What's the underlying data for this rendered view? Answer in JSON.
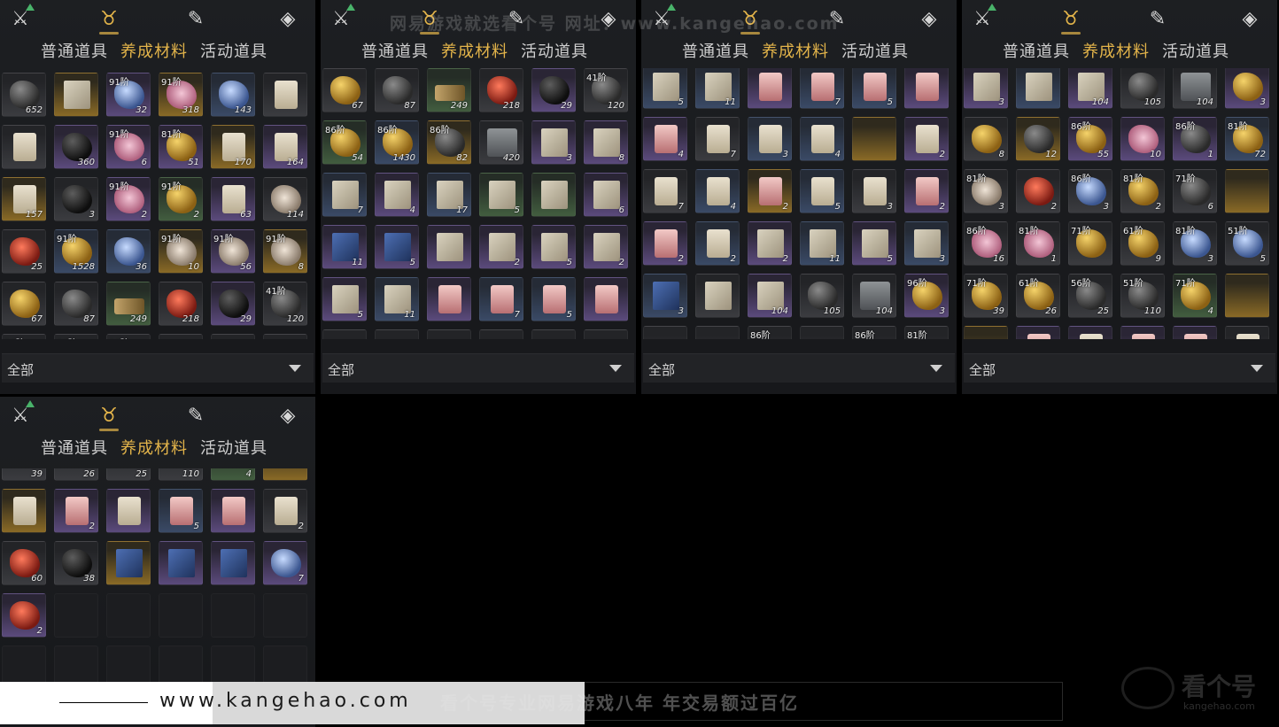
{
  "panels": [
    {
      "icons": [
        "crossed-swords-icon",
        "pouch-icon",
        "scroll-icon",
        "token-icon"
      ],
      "active_icon": 1,
      "tabs": [
        "普通道具",
        "养成材料",
        "活动道具"
      ],
      "active_tab": 1,
      "filter": "全部",
      "rows": [
        [
          {
            "a": "rock",
            "r": "gray",
            "c": "652"
          },
          {
            "a": "book",
            "r": "gold",
            "c": ""
          },
          {
            "a": "blue",
            "r": "purple",
            "t": "91阶",
            "c": "32"
          },
          {
            "a": "flower",
            "r": "gold",
            "t": "91阶",
            "c": "318"
          },
          {
            "a": "blue",
            "r": "blue",
            "c": "143"
          },
          {
            "a": "scroll",
            "r": "gray",
            "c": ""
          }
        ],
        [
          {
            "a": "scroll",
            "r": "gray",
            "c": ""
          },
          {
            "a": "dark",
            "r": "purple",
            "c": "360"
          },
          {
            "a": "flower",
            "r": "purple",
            "t": "91阶",
            "c": "6"
          },
          {
            "a": "ore",
            "r": "purple",
            "t": "81阶",
            "c": "51"
          },
          {
            "a": "scroll",
            "r": "gold",
            "c": "170"
          },
          {
            "a": "scroll",
            "r": "purple",
            "c": "164"
          }
        ],
        [
          {
            "a": "scroll",
            "r": "gold",
            "c": "157"
          },
          {
            "a": "dark",
            "r": "gray",
            "c": "3"
          },
          {
            "a": "flower",
            "r": "purple",
            "t": "91阶",
            "c": "2"
          },
          {
            "a": "ore",
            "r": "green",
            "t": "91阶",
            "c": "2"
          },
          {
            "a": "scroll",
            "r": "purple",
            "c": "63"
          },
          {
            "a": "shell",
            "r": "gray",
            "c": "114"
          }
        ],
        [
          {
            "a": "red",
            "r": "gray",
            "c": "25"
          },
          {
            "a": "ore",
            "r": "blue",
            "t": "91阶",
            "c": "1528"
          },
          {
            "a": "blue",
            "r": "blue",
            "c": "36"
          },
          {
            "a": "shell",
            "r": "gold",
            "t": "91阶",
            "c": "10"
          },
          {
            "a": "shell",
            "r": "purple",
            "t": "91阶",
            "c": "56"
          },
          {
            "a": "shell",
            "r": "gold",
            "t": "91阶",
            "c": "8"
          }
        ],
        [
          {
            "a": "ore",
            "r": "gray",
            "c": "67"
          },
          {
            "a": "rock",
            "r": "gray",
            "c": "87"
          },
          {
            "a": "wood",
            "r": "green",
            "c": "249"
          },
          {
            "a": "red",
            "r": "gray",
            "c": "218"
          },
          {
            "a": "dark",
            "r": "purple",
            "c": "29"
          },
          {
            "a": "rock",
            "r": "gray",
            "t": "41阶",
            "c": "120"
          }
        ],
        [
          {
            "a": "none",
            "r": "gray",
            "t": "86阶",
            "c": ""
          },
          {
            "a": "none",
            "r": "gray",
            "t": "86阶",
            "c": ""
          },
          {
            "a": "none",
            "r": "gray",
            "t": "86阶",
            "c": ""
          },
          {
            "a": "none",
            "r": "gray",
            "c": ""
          },
          {
            "a": "none",
            "r": "gray",
            "c": ""
          },
          {
            "a": "none",
            "r": "gray",
            "c": ""
          }
        ]
      ]
    },
    {
      "icons": [
        "crossed-swords-icon",
        "pouch-icon",
        "scroll-icon",
        "token-icon"
      ],
      "active_icon": 1,
      "tabs": [
        "普通道具",
        "养成材料",
        "活动道具"
      ],
      "active_tab": 1,
      "filter": "全部",
      "rows": [
        [
          {
            "a": "ore",
            "r": "gray",
            "c": "67"
          },
          {
            "a": "rock",
            "r": "gray",
            "c": "87"
          },
          {
            "a": "wood",
            "r": "green",
            "c": "249"
          },
          {
            "a": "red",
            "r": "gray",
            "c": "218"
          },
          {
            "a": "dark",
            "r": "purple",
            "c": "29"
          },
          {
            "a": "rock",
            "r": "gray",
            "t": "41阶",
            "c": "120"
          }
        ],
        [
          {
            "a": "ore",
            "r": "green",
            "t": "86阶",
            "c": "54"
          },
          {
            "a": "ore",
            "r": "blue",
            "t": "86阶",
            "c": "1430"
          },
          {
            "a": "rock",
            "r": "gold",
            "t": "86阶",
            "c": "82"
          },
          {
            "a": "gray",
            "r": "gray",
            "c": "420"
          },
          {
            "a": "book",
            "r": "purple",
            "c": "3"
          },
          {
            "a": "book",
            "r": "purple",
            "c": "8"
          }
        ],
        [
          {
            "a": "book",
            "r": "blue",
            "c": "7"
          },
          {
            "a": "book",
            "r": "purple",
            "c": "4"
          },
          {
            "a": "book",
            "r": "blue",
            "c": "17"
          },
          {
            "a": "book",
            "r": "green",
            "c": "5"
          },
          {
            "a": "book",
            "r": "green",
            "c": ""
          },
          {
            "a": "book",
            "r": "purple",
            "c": "6"
          }
        ],
        [
          {
            "a": "bluebook",
            "r": "purple",
            "c": "11"
          },
          {
            "a": "bluebook",
            "r": "purple",
            "c": "5"
          },
          {
            "a": "book",
            "r": "purple",
            "c": ""
          },
          {
            "a": "book",
            "r": "purple",
            "c": "2"
          },
          {
            "a": "book",
            "r": "purple",
            "c": "5"
          },
          {
            "a": "book",
            "r": "purple",
            "c": "2"
          }
        ],
        [
          {
            "a": "book",
            "r": "purple",
            "c": "5"
          },
          {
            "a": "book",
            "r": "blue",
            "c": "11"
          },
          {
            "a": "pink",
            "r": "purple",
            "c": ""
          },
          {
            "a": "pink",
            "r": "blue",
            "c": "7"
          },
          {
            "a": "pink",
            "r": "blue",
            "c": "5"
          },
          {
            "a": "pink",
            "r": "purple",
            "c": ""
          }
        ],
        [
          {
            "a": "none",
            "r": "gray",
            "c": ""
          },
          {
            "a": "none",
            "r": "gray",
            "c": ""
          },
          {
            "a": "none",
            "r": "gray",
            "c": ""
          },
          {
            "a": "none",
            "r": "gray",
            "c": ""
          },
          {
            "a": "none",
            "r": "gray",
            "c": ""
          },
          {
            "a": "none",
            "r": "gray",
            "c": ""
          }
        ]
      ]
    },
    {
      "icons": [
        "crossed-swords-icon",
        "pouch-icon",
        "scroll-icon",
        "token-icon"
      ],
      "active_icon": 1,
      "tabs": [
        "普通道具",
        "养成材料",
        "活动道具"
      ],
      "active_tab": 1,
      "filter": "全部",
      "rows": [
        [
          {
            "a": "book",
            "r": "blue",
            "c": "5"
          },
          {
            "a": "book",
            "r": "blue",
            "c": "11"
          },
          {
            "a": "pink",
            "r": "purple",
            "c": ""
          },
          {
            "a": "pink",
            "r": "blue",
            "c": "7"
          },
          {
            "a": "pink",
            "r": "blue",
            "c": "5"
          },
          {
            "a": "pink",
            "r": "purple",
            "c": ""
          }
        ],
        [
          {
            "a": "pink",
            "r": "purple",
            "c": "4"
          },
          {
            "a": "scroll",
            "r": "gray",
            "c": "7"
          },
          {
            "a": "scroll",
            "r": "blue",
            "c": "3"
          },
          {
            "a": "scroll",
            "r": "blue",
            "c": "4"
          },
          {
            "a": "none",
            "r": "gold",
            "c": ""
          },
          {
            "a": "scroll",
            "r": "purple",
            "c": "2"
          }
        ],
        [
          {
            "a": "scroll",
            "r": "gray",
            "c": "7"
          },
          {
            "a": "scroll",
            "r": "blue",
            "c": "4"
          },
          {
            "a": "pink",
            "r": "gold",
            "c": "2"
          },
          {
            "a": "scroll",
            "r": "blue",
            "c": "5"
          },
          {
            "a": "scroll",
            "r": "gray",
            "c": "3"
          },
          {
            "a": "pink",
            "r": "purple",
            "c": "2"
          }
        ],
        [
          {
            "a": "pink",
            "r": "purple",
            "c": "2"
          },
          {
            "a": "scroll",
            "r": "blue",
            "c": "2"
          },
          {
            "a": "book",
            "r": "purple",
            "c": "2"
          },
          {
            "a": "book",
            "r": "blue",
            "c": "11"
          },
          {
            "a": "book",
            "r": "purple",
            "c": "5"
          },
          {
            "a": "book",
            "r": "blue",
            "c": "3"
          }
        ],
        [
          {
            "a": "bluebook",
            "r": "blue",
            "c": "3"
          },
          {
            "a": "book",
            "r": "gray",
            "c": ""
          },
          {
            "a": "book",
            "r": "purple",
            "c": "104"
          },
          {
            "a": "rock",
            "r": "gray",
            "c": "105"
          },
          {
            "a": "gray",
            "r": "gray",
            "c": "104"
          },
          {
            "a": "ore",
            "r": "purple",
            "t": "96阶",
            "c": "3"
          }
        ],
        [
          {
            "a": "none",
            "r": "gray",
            "c": ""
          },
          {
            "a": "none",
            "r": "gray",
            "c": ""
          },
          {
            "a": "none",
            "r": "gray",
            "t": "86阶",
            "c": ""
          },
          {
            "a": "none",
            "r": "gray",
            "c": ""
          },
          {
            "a": "none",
            "r": "gray",
            "t": "86阶",
            "c": ""
          },
          {
            "a": "none",
            "r": "gray",
            "t": "81阶",
            "c": ""
          }
        ]
      ]
    },
    {
      "icons": [
        "crossed-swords-icon",
        "pouch-icon",
        "scroll-icon",
        "token-icon"
      ],
      "active_icon": 1,
      "tabs": [
        "普通道具",
        "养成材料",
        "活动道具"
      ],
      "active_tab": 1,
      "filter": "全部",
      "rows": [
        [
          {
            "a": "book",
            "r": "purple",
            "c": "3"
          },
          {
            "a": "book",
            "r": "blue",
            "c": ""
          },
          {
            "a": "book",
            "r": "purple",
            "c": "104"
          },
          {
            "a": "rock",
            "r": "gray",
            "c": "105"
          },
          {
            "a": "gray",
            "r": "gray",
            "c": "104"
          },
          {
            "a": "ore",
            "r": "purple",
            "c": "3"
          }
        ],
        [
          {
            "a": "ore",
            "r": "gray",
            "c": "8"
          },
          {
            "a": "rock",
            "r": "gold",
            "c": "12"
          },
          {
            "a": "ore",
            "r": "purple",
            "t": "86阶",
            "c": "55"
          },
          {
            "a": "flower",
            "r": "purple",
            "c": "10"
          },
          {
            "a": "rock",
            "r": "purple",
            "t": "86阶",
            "c": "1"
          },
          {
            "a": "ore",
            "r": "blue",
            "t": "81阶",
            "c": "72"
          }
        ],
        [
          {
            "a": "shell",
            "r": "gray",
            "t": "81阶",
            "c": "3"
          },
          {
            "a": "red",
            "r": "gray",
            "c": "2"
          },
          {
            "a": "blue",
            "r": "gray",
            "t": "86阶",
            "c": "3"
          },
          {
            "a": "ore",
            "r": "gray",
            "t": "81阶",
            "c": "2"
          },
          {
            "a": "rock",
            "r": "gray",
            "t": "71阶",
            "c": "6"
          },
          {
            "a": "none",
            "r": "gold",
            "c": ""
          }
        ],
        [
          {
            "a": "flower",
            "r": "gray",
            "t": "86阶",
            "c": "16"
          },
          {
            "a": "flower",
            "r": "gray",
            "t": "81阶",
            "c": "1"
          },
          {
            "a": "ore",
            "r": "gray",
            "t": "71阶",
            "c": ""
          },
          {
            "a": "ore",
            "r": "gray",
            "t": "61阶",
            "c": "9"
          },
          {
            "a": "blue",
            "r": "gray",
            "t": "81阶",
            "c": "3"
          },
          {
            "a": "blue",
            "r": "gray",
            "t": "51阶",
            "c": "5"
          }
        ],
        [
          {
            "a": "ore",
            "r": "gray",
            "t": "71阶",
            "c": "39"
          },
          {
            "a": "ore",
            "r": "gray",
            "t": "61阶",
            "c": "26"
          },
          {
            "a": "rock",
            "r": "gray",
            "t": "56阶",
            "c": "25"
          },
          {
            "a": "rock",
            "r": "gray",
            "t": "51阶",
            "c": "110"
          },
          {
            "a": "ore",
            "r": "green",
            "t": "71阶",
            "c": "4"
          },
          {
            "a": "none",
            "r": "gold",
            "c": ""
          }
        ],
        [
          {
            "a": "none",
            "r": "gold",
            "c": ""
          },
          {
            "a": "pink",
            "r": "purple",
            "c": ""
          },
          {
            "a": "scroll",
            "r": "purple",
            "c": ""
          },
          {
            "a": "pink",
            "r": "purple",
            "c": ""
          },
          {
            "a": "pink",
            "r": "purple",
            "c": ""
          },
          {
            "a": "scroll",
            "r": "gray",
            "c": ""
          }
        ]
      ]
    }
  ],
  "bottom_panel": {
    "icons": [
      "crossed-swords-icon",
      "pouch-icon",
      "scroll-icon",
      "token-icon"
    ],
    "active_icon": 1,
    "tabs": [
      "普通道具",
      "养成材料",
      "活动道具"
    ],
    "active_tab": 1,
    "rows": [
      [
        {
          "a": "none",
          "r": "gray",
          "c": "39"
        },
        {
          "a": "none",
          "r": "gray",
          "c": "26"
        },
        {
          "a": "none",
          "r": "gray",
          "c": "25"
        },
        {
          "a": "none",
          "r": "gray",
          "c": "110"
        },
        {
          "a": "none",
          "r": "green",
          "c": "4"
        },
        {
          "a": "none",
          "r": "gold",
          "c": ""
        }
      ],
      [
        {
          "a": "scroll",
          "r": "gold",
          "c": ""
        },
        {
          "a": "pink",
          "r": "purple",
          "c": "2"
        },
        {
          "a": "scroll",
          "r": "purple",
          "c": ""
        },
        {
          "a": "pink",
          "r": "blue",
          "c": "5"
        },
        {
          "a": "pink",
          "r": "purple",
          "c": ""
        },
        {
          "a": "scroll",
          "r": "gray",
          "c": "2"
        }
      ],
      [
        {
          "a": "red",
          "r": "gray",
          "c": "60"
        },
        {
          "a": "dark",
          "r": "gray",
          "c": "38"
        },
        {
          "a": "bluebook",
          "r": "gold",
          "c": ""
        },
        {
          "a": "bluebook",
          "r": "purple",
          "c": ""
        },
        {
          "a": "bluebook",
          "r": "purple",
          "c": ""
        },
        {
          "a": "blue",
          "r": "purple",
          "c": "7"
        }
      ],
      [
        {
          "a": "red",
          "r": "purple",
          "c": "2"
        },
        {
          "a": "none",
          "r": "empty",
          "c": ""
        },
        {
          "a": "none",
          "r": "empty",
          "c": ""
        },
        {
          "a": "none",
          "r": "empty",
          "c": ""
        },
        {
          "a": "none",
          "r": "empty",
          "c": ""
        },
        {
          "a": "none",
          "r": "empty",
          "c": ""
        }
      ],
      [
        {
          "a": "none",
          "r": "empty",
          "c": ""
        },
        {
          "a": "none",
          "r": "empty",
          "c": ""
        },
        {
          "a": "none",
          "r": "empty",
          "c": ""
        },
        {
          "a": "none",
          "r": "empty",
          "c": ""
        },
        {
          "a": "none",
          "r": "empty",
          "c": ""
        },
        {
          "a": "none",
          "r": "empty",
          "c": ""
        }
      ]
    ]
  },
  "watermark_top": "网易游戏就选看个号   网址：www.kangehao.com",
  "footer": {
    "site": "www.kangehao.com",
    "slogan": "看个号专业网易游戏八年   年交易额过百亿",
    "brand_name": "看个号",
    "brand_sub": "kangehao.com"
  },
  "colors": {
    "accent": "#e3b44a",
    "tab_inactive": "#cfcfcf",
    "background": "#000000",
    "panel": "#1d1f22"
  }
}
